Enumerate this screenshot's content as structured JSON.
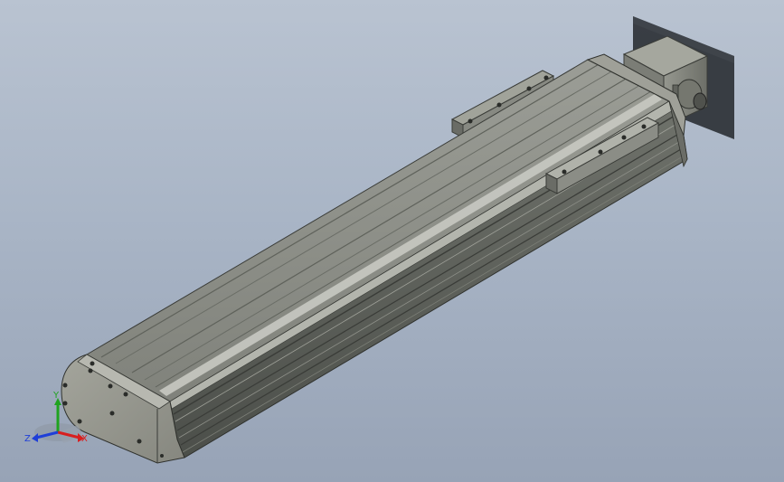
{
  "viewport": {
    "background_top": "#b9c3d1",
    "background_bottom": "#97a3b6"
  },
  "model": {
    "body_color": "#8f918a",
    "body_dark": "#5e615b",
    "end_cap_color": "#9a9b92",
    "motor_color": "#85877f",
    "shadow_color": "#2f3338"
  },
  "triad": {
    "x_label": "X",
    "y_label": "Y",
    "z_label": "Z",
    "x_color": "#d81f1f",
    "y_color": "#1fa31f",
    "z_color": "#1f3fd8"
  }
}
